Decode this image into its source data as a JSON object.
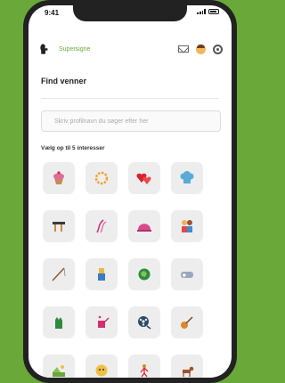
{
  "status": {
    "time": "9:41"
  },
  "app": {
    "title": "Supersigne"
  },
  "page": {
    "title": "Find venner",
    "search_placeholder": "Skriv profilnavn du søger efter her",
    "interests_label": "Vælg op til 5 interesser"
  },
  "interests": [
    "cupcake-icon",
    "wreath-icon",
    "hearts-icon",
    "chef-hat-icon",
    "tools-icon",
    "thread-icon",
    "dome-hat-icon",
    "family-icon",
    "fishing-rod-icon",
    "clothes-icon",
    "globe-icon",
    "controller-icon",
    "glove-icon",
    "watering-can-icon",
    "film-reel-icon",
    "guitar-icon",
    "landscape-icon",
    "face-icon",
    "dancer-icon",
    "dog-icon"
  ]
}
